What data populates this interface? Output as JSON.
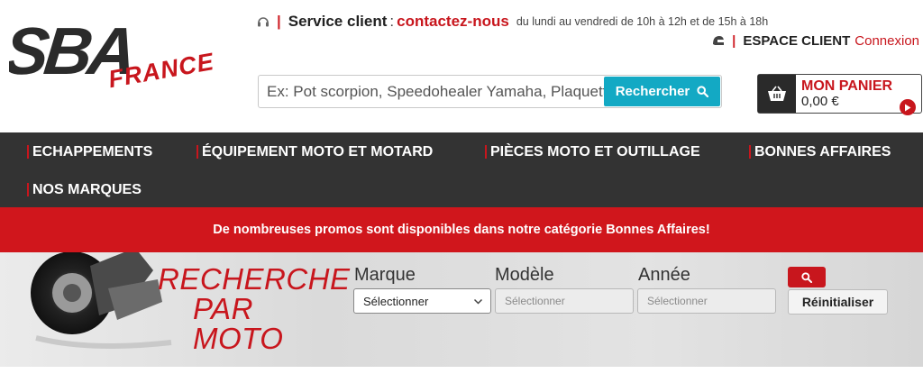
{
  "logo": {
    "brand": "SBA",
    "sub": "FRANCE"
  },
  "contact": {
    "label": "Service client",
    "colon": ":",
    "link": "contactez-nous",
    "hours": "du lundi au vendredi de 10h à 12h et de 15h à 18h"
  },
  "account": {
    "label": "ESPACE CLIENT",
    "link": "Connexion"
  },
  "search": {
    "placeholder": "Ex: Pot scorpion, Speedohealer Yamaha, Plaquettes",
    "button": "Rechercher"
  },
  "cart": {
    "title": "MON PANIER",
    "amount": "0,00 €"
  },
  "nav": {
    "items": [
      {
        "label": "ECHAPPEMENTS"
      },
      {
        "label": "ÉQUIPEMENT MOTO ET MOTARD"
      },
      {
        "label": "PIÈCES MOTO ET OUTILLAGE"
      },
      {
        "label": "BONNES AFFAIRES"
      },
      {
        "label": "NOS MARQUES"
      }
    ]
  },
  "promo": {
    "text": "De nombreuses promos sont disponibles dans notre catégorie Bonnes Affaires!"
  },
  "moto_search": {
    "title_lines": [
      "RECHERCHE",
      "PAR",
      "MOTO"
    ],
    "fields": [
      {
        "label": "Marque",
        "value": "Sélectionner"
      },
      {
        "label": "Modèle",
        "value": "Sélectionner"
      },
      {
        "label": "Année",
        "value": "Sélectionner"
      }
    ],
    "reset": "Réinitialiser"
  },
  "colors": {
    "brand_red": "#c8161d",
    "search_button": "#13a9c4",
    "nav_bg": "#333333"
  },
  "icons": [
    "headset-icon",
    "helmet-icon",
    "search-icon",
    "basket-icon",
    "play-arrow-icon",
    "chevron-down-icon"
  ]
}
